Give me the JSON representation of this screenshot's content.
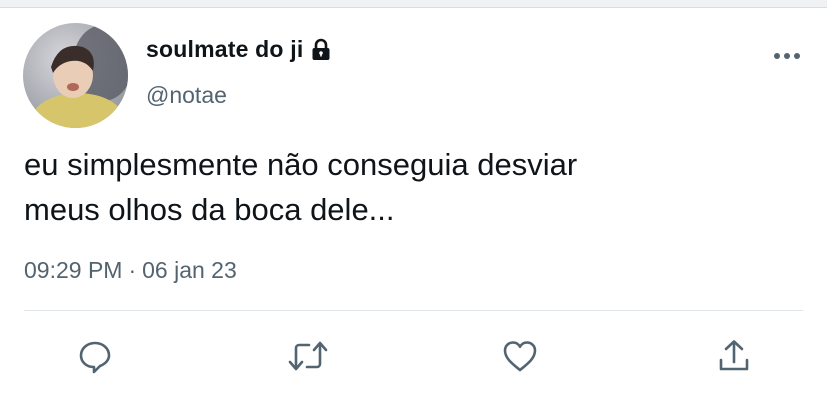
{
  "colors": {
    "text": "#0f1419",
    "muted": "#536471",
    "icon": "#536471"
  },
  "tweet": {
    "display_name": "soulmate do ji",
    "handle": "@notae",
    "body_lines": [
      "eu simplesmente não conseguia desviar",
      "meus olhos da boca dele..."
    ],
    "time": "09:29 PM",
    "separator": "·",
    "date": "06 jan 23"
  },
  "icons": {
    "lock": "lock-icon",
    "more": "more-icon",
    "reply": "reply-icon",
    "retweet": "retweet-icon",
    "like": "like-icon",
    "share": "share-icon"
  }
}
